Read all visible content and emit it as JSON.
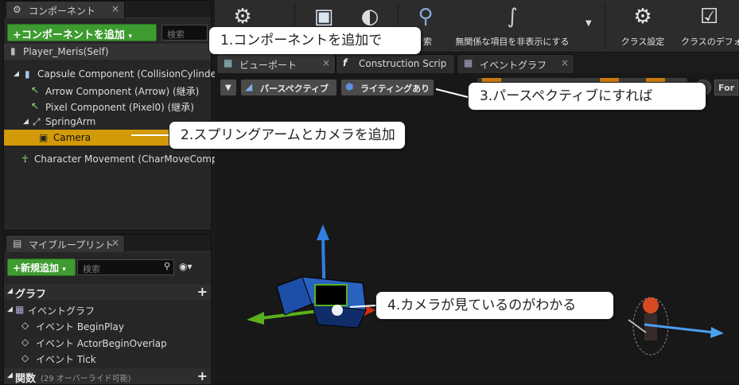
{
  "components_panel": {
    "tab_label": "コンポーネント",
    "add_button": "+コンポーネントを追加",
    "search_placeholder": "検索",
    "self_item": "Player_Meris(Self)",
    "tree": [
      {
        "label": "Capsule Component (CollisionCylinder)",
        "icon": "capsule-icon"
      },
      {
        "label": "Arrow Component (Arrow) (継承)",
        "icon": "arrow-icon"
      },
      {
        "label": "Pixel Component (Pixel0) (継承)",
        "icon": "pixel-icon"
      },
      {
        "label": "SpringArm",
        "icon": "springarm-icon"
      },
      {
        "label": "Camera",
        "icon": "camera-icon"
      },
      {
        "label": "Character Movement (CharMoveComp)",
        "icon": "movement-icon"
      }
    ]
  },
  "blueprint_panel": {
    "tab_label": "マイブループリント",
    "add_button": "+新規追加",
    "search_placeholder": "検索",
    "graph_header": "グラフ",
    "event_graph": "イベントグラフ",
    "events": [
      "イベント BeginPlay",
      "イベント ActorBeginOverlap",
      "イベント Tick"
    ],
    "functions_header": "関数",
    "functions_note": "(29 オーバーライド可能)"
  },
  "toolbar": {
    "buttons": [
      {
        "label": "",
        "icon": "compile-icon"
      },
      {
        "label": "",
        "icon": "save-icon"
      },
      {
        "label": "",
        "icon": "browse-icon"
      },
      {
        "label": "索",
        "icon": "search-icon"
      },
      {
        "label": "無関係な項目を非表示にする",
        "icon": "hide-unrelated-icon"
      },
      {
        "label": "クラス設定",
        "icon": "class-settings-icon"
      },
      {
        "label": "クラスのデフォ",
        "icon": "class-defaults-icon"
      }
    ]
  },
  "doc_tabs": [
    {
      "label": "ビューポート",
      "icon": "viewport-icon"
    },
    {
      "label": "Construction Scrip",
      "icon": "function-icon"
    },
    {
      "label": "イベントグラフ",
      "icon": "eventgraph-icon"
    }
  ],
  "viewport": {
    "perspective_button": "パースペクティブ",
    "lighting_button": "ライティングあり",
    "right_label": "For"
  },
  "callouts": [
    "1.コンポーネントを追加で",
    "2.スプリングアームとカメラを追加",
    "3.パースペクティブにすれば",
    "4.カメラが見ているのがわかる"
  ],
  "colors": {
    "selection": "#d29a08",
    "green_button": "#3e9b30",
    "gizmo_x": "#d03010",
    "gizmo_y": "#5ab01e",
    "gizmo_z": "#2f7fe0"
  }
}
